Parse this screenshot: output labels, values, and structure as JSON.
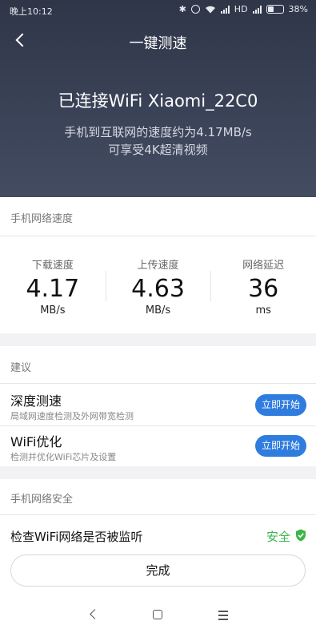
{
  "status_bar": {
    "time": "晚上10:12",
    "network": "HD",
    "battery": "38%"
  },
  "header": {
    "title": "一键测速"
  },
  "hero": {
    "connected": "已连接WiFi Xiaomi_22C0",
    "speed_line": "手机到互联网的速度约为4.17MB/s",
    "video_line": "可享受4K超清视频"
  },
  "speed_section": {
    "heading": "手机网络速度",
    "metrics": [
      {
        "label": "下载速度",
        "value": "4.17",
        "unit": "MB/s"
      },
      {
        "label": "上传速度",
        "value": "4.63",
        "unit": "MB/s"
      },
      {
        "label": "网络延迟",
        "value": "36",
        "unit": "ms"
      }
    ]
  },
  "suggestions": {
    "heading": "建议",
    "items": [
      {
        "title": "深度测速",
        "desc": "局域网速度检测及外网带宽检测",
        "button": "立即开始"
      },
      {
        "title": "WiFi优化",
        "desc": "检测并优化WiFi芯片及设置",
        "button": "立即开始"
      }
    ]
  },
  "security": {
    "heading": "手机网络安全",
    "row": {
      "label": "检查WiFi网络是否被监听",
      "status": "安全"
    }
  },
  "done_button": "完成",
  "colors": {
    "accent_blue": "#2f7cdf",
    "safe_green": "#3ab54a",
    "header_bg": "#353c50"
  }
}
